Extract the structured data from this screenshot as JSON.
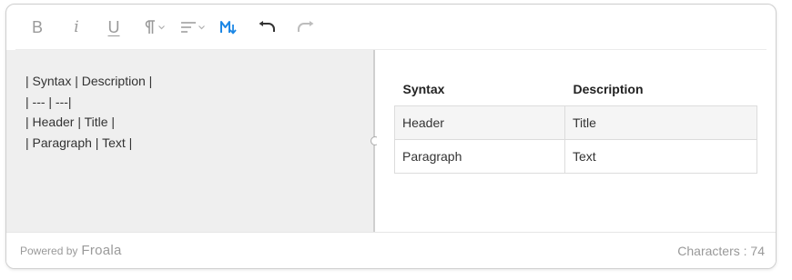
{
  "toolbar": {
    "bold": "B",
    "italic": "i",
    "underline": "U",
    "accent_color": "#1e88e5",
    "buttons": [
      "bold-icon",
      "italic-icon",
      "underline-icon",
      "paragraph-format-icon",
      "align-icon",
      "markdown-icon",
      "undo-icon",
      "redo-icon"
    ]
  },
  "markdown": {
    "lines": [
      "| Syntax | Description |",
      "| --- | ---|",
      "| Header | Title |",
      "| Paragraph | Text |"
    ]
  },
  "preview": {
    "headers": [
      "Syntax",
      "Description"
    ],
    "rows": [
      [
        "Header",
        "Title"
      ],
      [
        "Paragraph",
        "Text"
      ]
    ]
  },
  "footer": {
    "powered_by": "Powered by",
    "brand": "Froala",
    "char_label": "Characters",
    "char_count": "74"
  }
}
